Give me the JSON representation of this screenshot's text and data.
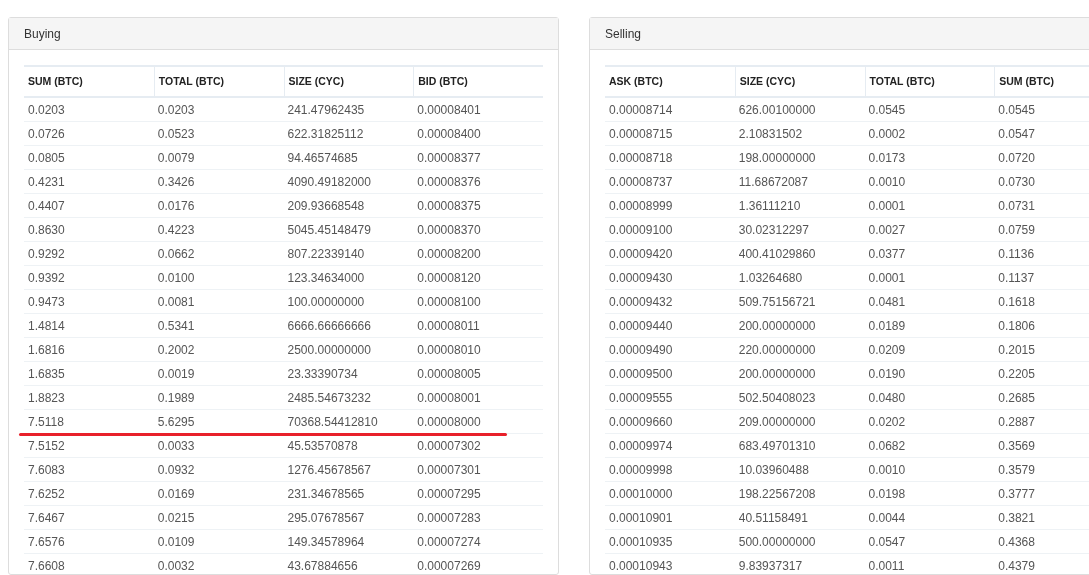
{
  "panels": [
    {
      "title": "Buying",
      "columns": [
        "SUM (BTC)",
        "TOTAL (BTC)",
        "SIZE (CYC)",
        "BID (BTC)"
      ],
      "rows": [
        {
          "cells": [
            "0.0203",
            "0.0203",
            "241.47962435",
            "0.00008401"
          ],
          "underlined": false
        },
        {
          "cells": [
            "0.0726",
            "0.0523",
            "622.31825112",
            "0.00008400"
          ],
          "underlined": false
        },
        {
          "cells": [
            "0.0805",
            "0.0079",
            "94.46574685",
            "0.00008377"
          ],
          "underlined": false
        },
        {
          "cells": [
            "0.4231",
            "0.3426",
            "4090.49182000",
            "0.00008376"
          ],
          "underlined": false
        },
        {
          "cells": [
            "0.4407",
            "0.0176",
            "209.93668548",
            "0.00008375"
          ],
          "underlined": false
        },
        {
          "cells": [
            "0.8630",
            "0.4223",
            "5045.45148479",
            "0.00008370"
          ],
          "underlined": false
        },
        {
          "cells": [
            "0.9292",
            "0.0662",
            "807.22339140",
            "0.00008200"
          ],
          "underlined": false
        },
        {
          "cells": [
            "0.9392",
            "0.0100",
            "123.34634000",
            "0.00008120"
          ],
          "underlined": false
        },
        {
          "cells": [
            "0.9473",
            "0.0081",
            "100.00000000",
            "0.00008100"
          ],
          "underlined": false
        },
        {
          "cells": [
            "1.4814",
            "0.5341",
            "6666.66666666",
            "0.00008011"
          ],
          "underlined": false
        },
        {
          "cells": [
            "1.6816",
            "0.2002",
            "2500.00000000",
            "0.00008010"
          ],
          "underlined": false
        },
        {
          "cells": [
            "1.6835",
            "0.0019",
            "23.33390734",
            "0.00008005"
          ],
          "underlined": false
        },
        {
          "cells": [
            "1.8823",
            "0.1989",
            "2485.54673232",
            "0.00008001"
          ],
          "underlined": false
        },
        {
          "cells": [
            "7.5118",
            "5.6295",
            "70368.54412810",
            "0.00008000"
          ],
          "underlined": true
        },
        {
          "cells": [
            "7.5152",
            "0.0033",
            "45.53570878",
            "0.00007302"
          ],
          "underlined": false
        },
        {
          "cells": [
            "7.6083",
            "0.0932",
            "1276.45678567",
            "0.00007301"
          ],
          "underlined": false
        },
        {
          "cells": [
            "7.6252",
            "0.0169",
            "231.34678565",
            "0.00007295"
          ],
          "underlined": false
        },
        {
          "cells": [
            "7.6467",
            "0.0215",
            "295.07678567",
            "0.00007283"
          ],
          "underlined": false
        },
        {
          "cells": [
            "7.6576",
            "0.0109",
            "149.34578964",
            "0.00007274"
          ],
          "underlined": false
        },
        {
          "cells": [
            "7.6608",
            "0.0032",
            "43.67884656",
            "0.00007269"
          ],
          "underlined": false
        }
      ]
    },
    {
      "title": "Selling",
      "columns": [
        "ASK (BTC)",
        "SIZE (CYC)",
        "TOTAL (BTC)",
        "SUM (BTC)"
      ],
      "rows": [
        {
          "cells": [
            "0.00008714",
            "626.00100000",
            "0.0545",
            "0.0545"
          ],
          "underlined": false
        },
        {
          "cells": [
            "0.00008715",
            "2.10831502",
            "0.0002",
            "0.0547"
          ],
          "underlined": false
        },
        {
          "cells": [
            "0.00008718",
            "198.00000000",
            "0.0173",
            "0.0720"
          ],
          "underlined": false
        },
        {
          "cells": [
            "0.00008737",
            "11.68672087",
            "0.0010",
            "0.0730"
          ],
          "underlined": false
        },
        {
          "cells": [
            "0.00008999",
            "1.36111210",
            "0.0001",
            "0.0731"
          ],
          "underlined": false
        },
        {
          "cells": [
            "0.00009100",
            "30.02312297",
            "0.0027",
            "0.0759"
          ],
          "underlined": false
        },
        {
          "cells": [
            "0.00009420",
            "400.41029860",
            "0.0377",
            "0.1136"
          ],
          "underlined": false
        },
        {
          "cells": [
            "0.00009430",
            "1.03264680",
            "0.0001",
            "0.1137"
          ],
          "underlined": false
        },
        {
          "cells": [
            "0.00009432",
            "509.75156721",
            "0.0481",
            "0.1618"
          ],
          "underlined": false
        },
        {
          "cells": [
            "0.00009440",
            "200.00000000",
            "0.0189",
            "0.1806"
          ],
          "underlined": false
        },
        {
          "cells": [
            "0.00009490",
            "220.00000000",
            "0.0209",
            "0.2015"
          ],
          "underlined": false
        },
        {
          "cells": [
            "0.00009500",
            "200.00000000",
            "0.0190",
            "0.2205"
          ],
          "underlined": false
        },
        {
          "cells": [
            "0.00009555",
            "502.50408023",
            "0.0480",
            "0.2685"
          ],
          "underlined": false
        },
        {
          "cells": [
            "0.00009660",
            "209.00000000",
            "0.0202",
            "0.2887"
          ],
          "underlined": false
        },
        {
          "cells": [
            "0.00009974",
            "683.49701310",
            "0.0682",
            "0.3569"
          ],
          "underlined": false
        },
        {
          "cells": [
            "0.00009998",
            "10.03960488",
            "0.0010",
            "0.3579"
          ],
          "underlined": false
        },
        {
          "cells": [
            "0.00010000",
            "198.22567208",
            "0.0198",
            "0.3777"
          ],
          "underlined": false
        },
        {
          "cells": [
            "0.00010901",
            "40.51158491",
            "0.0044",
            "0.3821"
          ],
          "underlined": false
        },
        {
          "cells": [
            "0.00010935",
            "500.00000000",
            "0.0547",
            "0.4368"
          ],
          "underlined": false
        },
        {
          "cells": [
            "0.00010943",
            "9.83937317",
            "0.0011",
            "0.4379"
          ],
          "underlined": false
        }
      ]
    }
  ]
}
